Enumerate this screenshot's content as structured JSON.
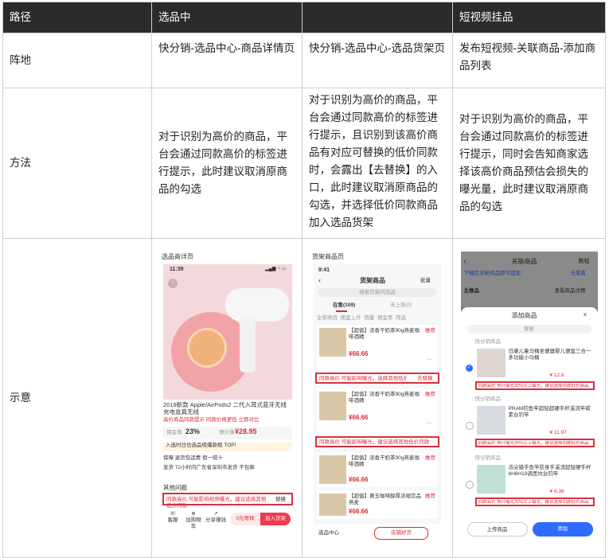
{
  "table": {
    "headers": [
      "路径",
      "选品中",
      "",
      "短视频挂品"
    ],
    "rows": [
      {
        "label": "阵地",
        "cells": [
          "快分销-选品中心-商品详情页",
          "快分销-选品中心-选品货架页",
          "发布短视频-关联商品-添加商品列表"
        ]
      },
      {
        "label": "方法",
        "cells": [
          "对于识别为高价的商品，平台会通过同款高价的标签进行提示，此时建议取消原商品的勾选",
          "对于识别为高价的商品，平台会通过同款高价的标签进行提示，且识别到该高价商品有对应可替换的低价同款时，会露出【去替换】的入口，此时建议取消原商品的勾选，并选择低价同款商品加入选品货架",
          "对于识别为高价的商品，平台会通过同款高价的标签进行提示，同时会告知商家选择该高价商品预估会损失的曝光量，此时建议取消原商品的勾选"
        ]
      },
      {
        "label": "示意"
      }
    ]
  },
  "screenshot1": {
    "caption": "选品商详页",
    "time": "11:39",
    "title": "2019新款 Apple/AirPods2 二代入耳式蓝牙无线充电盒真无线",
    "sold": "已售",
    "tags": "高价商品同款提示  同款价格更低  立即对比",
    "commission_label": "佣金率",
    "commission": "23%",
    "earn_label": "预计赚",
    "earn": "¥28.95",
    "rank": "入选时日也选品榜爆款榜 TOP!",
    "service": "保障  退货包运费  假一赔十",
    "ship": "发货  72小时内广东省深圳市发货  不包邮",
    "section": "其他问题",
    "warning": "同款高价 可能影响视频曝光，建议选择其他低价同款",
    "warning_link": "替换",
    "btn_shelf": "0元寄样",
    "btn_add": "加入货架",
    "nav": [
      "客服",
      "加购物车",
      "分享赚钱"
    ]
  },
  "screenshot2": {
    "caption": "货架商品页",
    "time": "9:41",
    "title": "货架商品",
    "batch": "批量",
    "search": "搜索货架内商品",
    "tabs": [
      "在售(109)",
      "未上架(0)"
    ],
    "filters": [
      "全部类目",
      "佣金上升",
      "销量",
      "佣金率",
      "筛选"
    ],
    "products": [
      {
        "name": "【超值】浓香干奶茶90g燕麦咖啡酒精",
        "price": "¥66.66",
        "tag": "推荐",
        "warn": "同款高价 可能影响曝光，选择其他低价同款",
        "action": "去替换"
      },
      {
        "name": "【超值】浓香干奶茶90g燕麦咖啡酒精",
        "price": "¥66.66",
        "tag": "推荐",
        "warn": "同款高价 可能影响曝光，建议选择其他低价同款",
        "action": ""
      },
      {
        "name": "【超值】浓香干奶茶90g燕麦咖啡酒精",
        "price": "¥66.66",
        "tag": "推荐",
        "warn": "",
        "action": ""
      },
      {
        "name": "【超值】黄玉咖啡醇厚浓缩饮品燕麦",
        "price": "¥66.66",
        "tag": "推荐",
        "warn": "",
        "action": ""
      }
    ],
    "bottom_left": "选品中心",
    "bottom_btn": "店铺好货"
  },
  "screenshot3": {
    "header": "关联商品",
    "header_right": "教程",
    "notice": "下载后关联商品即可提现",
    "notice_link": "去看看",
    "main_label": "主推品",
    "main_right": "查看商品详情",
    "modal_title": "添加商品",
    "search": "搜索",
    "products": [
      {
        "shop": "快分销商品",
        "name": "日康儿童马桶坐便器婴儿便盆三合一多功能小马桶",
        "price": "¥ 12.8",
        "warn": "同款高价 预计曝光30%以上曝光，建议选择同款低价商品"
      },
      {
        "shop": "快分销商品",
        "name": "PRAM钓鱼竿超轻超硬手杆溪流竿碳素台钓竿",
        "price": "¥ 11.97",
        "warn": "同款高价 预计曝光30%以上曝光，建议选择同款低价商品"
      },
      {
        "shop": "快分销商品",
        "name": "浓尖猎手鱼竿防身手溪流超轻硬手杆6H8H19调黑坑台钓竿",
        "price": "¥ 8.36",
        "warn": "同款高价 预计曝光30%以上曝光，建议选择同款低价商品"
      }
    ],
    "btn_upload": "上传商品",
    "btn_add": "添加"
  }
}
